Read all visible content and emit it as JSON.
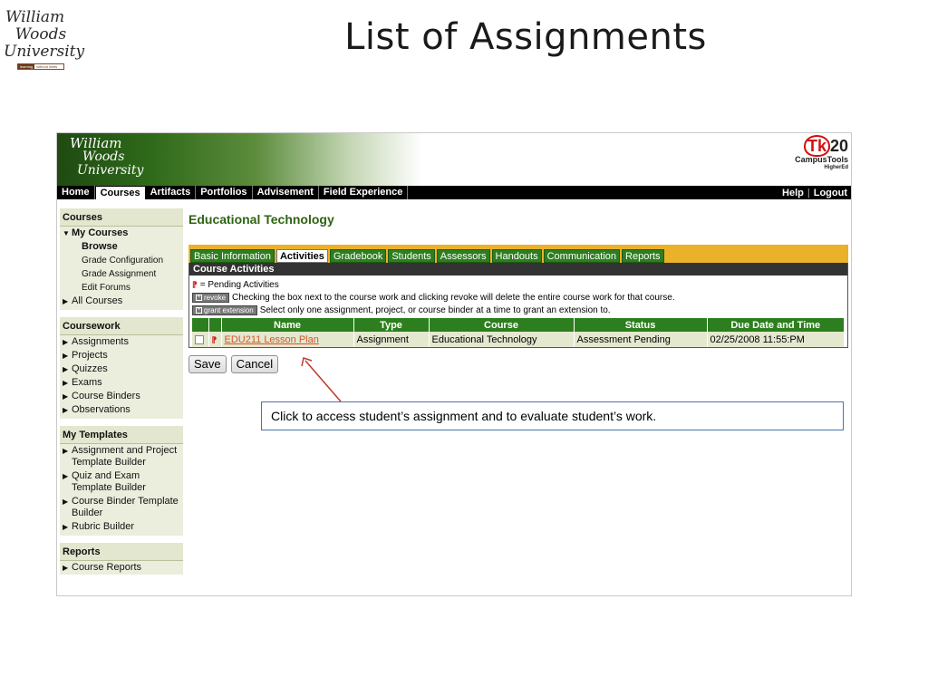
{
  "slide": {
    "title": "List of Assignments",
    "logo": {
      "line1": "William",
      "line2": "Woods",
      "line3": "University",
      "tag_a": "learning",
      "tag_b": "without limits"
    }
  },
  "app": {
    "logo": {
      "line1": "William",
      "line2": "Woods",
      "line3": "University"
    },
    "brand": {
      "tk": "Tk",
      "num": "20",
      "product": "CampusTools",
      "edition": "HigherEd"
    },
    "nav": {
      "items": [
        "Home",
        "Courses",
        "Artifacts",
        "Portfolios",
        "Advisement",
        "Field Experience"
      ],
      "active": "Courses",
      "help": "Help",
      "separator": "|",
      "logout": "Logout"
    },
    "sidebar": {
      "courses": {
        "heading": "Courses",
        "my_courses": "My Courses",
        "sub": [
          "Browse",
          "Grade Configuration",
          "Grade Assignment",
          "Edit Forums"
        ],
        "all_courses": "All Courses"
      },
      "coursework": {
        "heading": "Coursework",
        "items": [
          "Assignments",
          "Projects",
          "Quizzes",
          "Exams",
          "Course Binders",
          "Observations"
        ]
      },
      "templates": {
        "heading": "My Templates",
        "items": [
          "Assignment and Project Template Builder",
          "Quiz and Exam Template Builder",
          "Course Binder Template Builder",
          "Rubric Builder"
        ]
      },
      "reports": {
        "heading": "Reports",
        "items": [
          "Course Reports"
        ]
      }
    },
    "main": {
      "course_title": "Educational Technology",
      "tabs": [
        "Basic Information",
        "Activities",
        "Gradebook",
        "Students",
        "Assessors",
        "Handouts",
        "Communication",
        "Reports"
      ],
      "active_tab": "Activities",
      "panel_title": "Course Activities",
      "legend_pending": "= Pending Activities",
      "revoke_label": "revoke",
      "revoke_text": "Checking the box next to the course work and clicking revoke will delete the entire course work for that course.",
      "extension_label": "grant extension",
      "extension_text": "Select only one assignment, project, or course binder at a time to grant an extension to.",
      "table": {
        "columns": [
          "Name",
          "Type",
          "Course",
          "Status",
          "Due Date and Time"
        ],
        "rows": [
          {
            "name": "EDU211 Lesson Plan",
            "type": "Assignment",
            "course": "Educational Technology",
            "status": "Assessment Pending",
            "due": "02/25/2008 11:55:PM"
          }
        ]
      },
      "save": "Save",
      "cancel": "Cancel"
    }
  },
  "callout": "Click to access student’s assignment and to evaluate student’s work.",
  "colors": {
    "green": "#2d7e1e",
    "gold": "#eab22a",
    "title_green": "#2e6312",
    "link": "#d2572a",
    "row": "#e4e8cf"
  }
}
